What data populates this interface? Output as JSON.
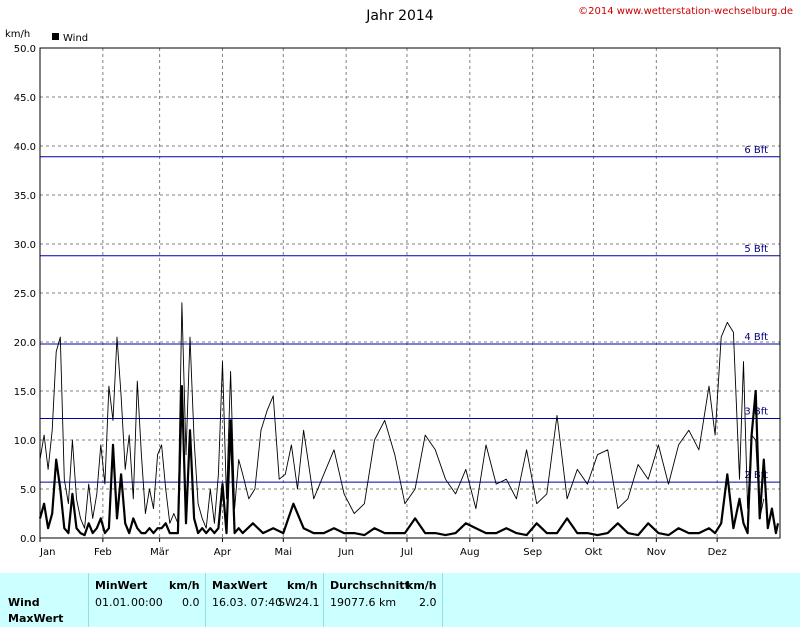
{
  "header": {
    "title": "Jahr 2014",
    "copyright": "©2014 www.wetterstation-wechselburg.de",
    "unit_label": "km/h"
  },
  "colors": {
    "plot_bg": "#ffffff",
    "grid": "#808080",
    "bft_line": "#0000aa",
    "bft_text": "#000080",
    "series": "#000000",
    "copyright": "#cc0000",
    "stats_bg": "#ccffff"
  },
  "chart_data": {
    "type": "line",
    "title": "Jahr 2014",
    "ylabel": "km/h",
    "xlabel": "",
    "ylim": [
      0,
      50
    ],
    "yticks": [
      "0.0",
      "5.0",
      "10.0",
      "15.0",
      "20.0",
      "25.0",
      "30.0",
      "35.0",
      "40.0",
      "45.0",
      "50.0"
    ],
    "xticks": [
      "Jan",
      "Feb",
      "Mär",
      "Apr",
      "Mai",
      "Jun",
      "Jul",
      "Aug",
      "Sep",
      "Okt",
      "Nov",
      "Dez"
    ],
    "grid": true,
    "legend": {
      "position": "top-left",
      "entries": [
        "Wind"
      ]
    },
    "beaufort_lines": [
      {
        "label": "2 Bft",
        "value": 5.7
      },
      {
        "label": "3 Bft",
        "value": 12.2
      },
      {
        "label": "4 Bft",
        "value": 19.8
      },
      {
        "label": "5 Bft",
        "value": 28.8
      },
      {
        "label": "6 Bft",
        "value": 38.9
      }
    ],
    "series": [
      {
        "name": "Wind",
        "style": "thick",
        "x_day": [
          0,
          2,
          4,
          6,
          8,
          10,
          12,
          14,
          16,
          18,
          20,
          22,
          24,
          26,
          28,
          30,
          32,
          34,
          36,
          38,
          40,
          42,
          44,
          46,
          48,
          50,
          52,
          54,
          56,
          58,
          60,
          62,
          64,
          66,
          68,
          70,
          72,
          74,
          76,
          78,
          80,
          82,
          84,
          86,
          88,
          90,
          92,
          94,
          96,
          98,
          100,
          105,
          110,
          115,
          120,
          125,
          130,
          135,
          140,
          145,
          150,
          155,
          160,
          165,
          170,
          175,
          180,
          185,
          190,
          195,
          200,
          205,
          210,
          215,
          220,
          225,
          230,
          235,
          240,
          245,
          250,
          255,
          260,
          265,
          270,
          275,
          280,
          285,
          290,
          295,
          300,
          305,
          310,
          315,
          320,
          325,
          330,
          333,
          336,
          339,
          342,
          345,
          347,
          349,
          351,
          353,
          355,
          357,
          359,
          361,
          363,
          364
        ],
        "values": [
          2.0,
          3.5,
          1.0,
          2.5,
          8.0,
          5.0,
          1.0,
          0.5,
          4.5,
          1.0,
          0.5,
          0.3,
          1.5,
          0.5,
          1.0,
          2.0,
          0.5,
          1.0,
          9.5,
          2.0,
          6.5,
          1.5,
          0.5,
          2.0,
          1.0,
          0.5,
          0.5,
          1.0,
          0.5,
          1.0,
          1.0,
          1.5,
          0.5,
          0.5,
          0.5,
          15.5,
          1.5,
          11.0,
          2.0,
          0.5,
          1.0,
          0.5,
          1.0,
          0.5,
          1.0,
          5.5,
          0.5,
          12.0,
          0.5,
          1.0,
          0.5,
          1.5,
          0.5,
          1.0,
          0.5,
          3.5,
          1.0,
          0.5,
          0.5,
          1.0,
          0.5,
          0.5,
          0.3,
          1.0,
          0.5,
          0.5,
          0.5,
          2.0,
          0.5,
          0.5,
          0.3,
          0.5,
          1.5,
          1.0,
          0.5,
          0.5,
          1.0,
          0.5,
          0.3,
          1.5,
          0.5,
          0.5,
          2.0,
          0.5,
          0.5,
          0.3,
          0.5,
          1.5,
          0.5,
          0.3,
          1.5,
          0.5,
          0.3,
          1.0,
          0.5,
          0.5,
          1.0,
          0.5,
          1.5,
          6.5,
          1.0,
          4.0,
          1.5,
          0.5,
          10.5,
          15.0,
          2.0,
          8.0,
          1.0,
          3.0,
          0.5,
          1.5
        ]
      },
      {
        "name": "MaxWert",
        "style": "thin",
        "x_day": [
          0,
          2,
          4,
          6,
          8,
          10,
          12,
          14,
          16,
          18,
          20,
          22,
          24,
          26,
          28,
          30,
          32,
          34,
          36,
          38,
          40,
          42,
          44,
          46,
          48,
          50,
          52,
          54,
          56,
          58,
          60,
          62,
          64,
          66,
          68,
          70,
          72,
          74,
          76,
          78,
          80,
          82,
          84,
          86,
          88,
          90,
          92,
          94,
          96,
          98,
          100,
          103,
          106,
          109,
          112,
          115,
          118,
          121,
          124,
          127,
          130,
          135,
          140,
          145,
          150,
          155,
          160,
          165,
          170,
          175,
          180,
          185,
          190,
          195,
          200,
          205,
          210,
          215,
          220,
          225,
          230,
          235,
          240,
          245,
          250,
          255,
          260,
          265,
          270,
          275,
          280,
          285,
          290,
          295,
          300,
          305,
          310,
          315,
          320,
          325,
          330,
          333,
          336,
          339,
          342,
          345,
          347,
          349,
          351,
          353,
          355,
          357,
          359,
          361,
          363,
          364
        ],
        "values": [
          8.0,
          10.5,
          7.0,
          11.0,
          19.0,
          20.5,
          6.0,
          3.5,
          10.0,
          4.0,
          2.0,
          1.0,
          5.5,
          2.0,
          4.5,
          9.5,
          5.5,
          15.5,
          12.0,
          20.5,
          14.5,
          7.0,
          10.5,
          4.0,
          16.0,
          8.5,
          2.5,
          5.0,
          3.0,
          8.5,
          9.5,
          5.0,
          1.5,
          2.5,
          1.5,
          24.0,
          8.5,
          20.5,
          10.0,
          3.5,
          2.0,
          1.0,
          5.0,
          1.5,
          6.5,
          18.0,
          4.0,
          17.0,
          3.0,
          8.0,
          6.5,
          4.0,
          5.0,
          11.0,
          13.0,
          14.5,
          6.0,
          6.5,
          9.5,
          5.0,
          11.0,
          4.0,
          6.5,
          9.0,
          4.5,
          2.5,
          3.5,
          10.0,
          12.0,
          8.5,
          3.5,
          5.0,
          10.5,
          9.0,
          6.0,
          4.5,
          7.0,
          3.0,
          9.5,
          5.5,
          6.0,
          4.0,
          9.0,
          3.5,
          4.5,
          12.5,
          4.0,
          7.0,
          5.5,
          8.5,
          9.0,
          3.0,
          4.0,
          7.5,
          6.0,
          9.5,
          5.5,
          9.5,
          11.0,
          9.0,
          15.5,
          10.5,
          20.5,
          22.0,
          21.0,
          6.0,
          18.0,
          3.0,
          10.5,
          10.0,
          2.0,
          4.0
        ]
      }
    ]
  },
  "stats": {
    "row_labels": [
      "Wind",
      "MaxWert"
    ],
    "headers": {
      "min_label": "MinWert",
      "min_unit": "km/h",
      "max_label": "MaxWert",
      "max_unit": "km/h",
      "avg_label": "Durchschnitt",
      "avg_unit": "km/h"
    },
    "wind": {
      "min_date": "01.01.",
      "min_time": "00:00",
      "min_value": "0.0",
      "max_datetime": "16.03. 07:40",
      "max_dir": "SW",
      "max_value": "24.1",
      "avg_distance": "19077.6 km",
      "avg_value": "2.0"
    }
  }
}
